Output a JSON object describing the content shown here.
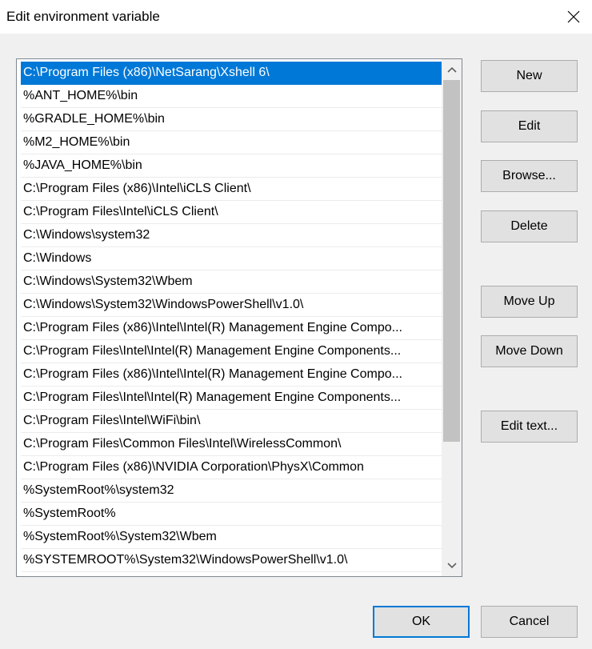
{
  "window": {
    "title": "Edit environment variable"
  },
  "path_list": {
    "selected_index": 0,
    "items": [
      "C:\\Program Files (x86)\\NetSarang\\Xshell 6\\",
      "%ANT_HOME%\\bin",
      "%GRADLE_HOME%\\bin",
      "%M2_HOME%\\bin",
      "%JAVA_HOME%\\bin",
      "C:\\Program Files (x86)\\Intel\\iCLS Client\\",
      "C:\\Program Files\\Intel\\iCLS Client\\",
      "C:\\Windows\\system32",
      "C:\\Windows",
      "C:\\Windows\\System32\\Wbem",
      "C:\\Windows\\System32\\WindowsPowerShell\\v1.0\\",
      "C:\\Program Files (x86)\\Intel\\Intel(R) Management Engine Compo...",
      "C:\\Program Files\\Intel\\Intel(R) Management Engine Components...",
      "C:\\Program Files (x86)\\Intel\\Intel(R) Management Engine Compo...",
      "C:\\Program Files\\Intel\\Intel(R) Management Engine Components...",
      "C:\\Program Files\\Intel\\WiFi\\bin\\",
      "C:\\Program Files\\Common Files\\Intel\\WirelessCommon\\",
      "C:\\Program Files (x86)\\NVIDIA Corporation\\PhysX\\Common",
      "%SystemRoot%\\system32",
      "%SystemRoot%",
      "%SystemRoot%\\System32\\Wbem",
      "%SYSTEMROOT%\\System32\\WindowsPowerShell\\v1.0\\"
    ]
  },
  "buttons": {
    "new": "New",
    "edit": "Edit",
    "browse": "Browse...",
    "delete": "Delete",
    "move_up": "Move Up",
    "move_down": "Move Down",
    "edit_text": "Edit text...",
    "ok": "OK",
    "cancel": "Cancel"
  },
  "colors": {
    "selection": "#0078d7",
    "default_button_border": "#0078d7"
  },
  "icons": {
    "close": "close-icon",
    "scroll_up": "chevron-up-icon",
    "scroll_down": "chevron-down-icon"
  }
}
